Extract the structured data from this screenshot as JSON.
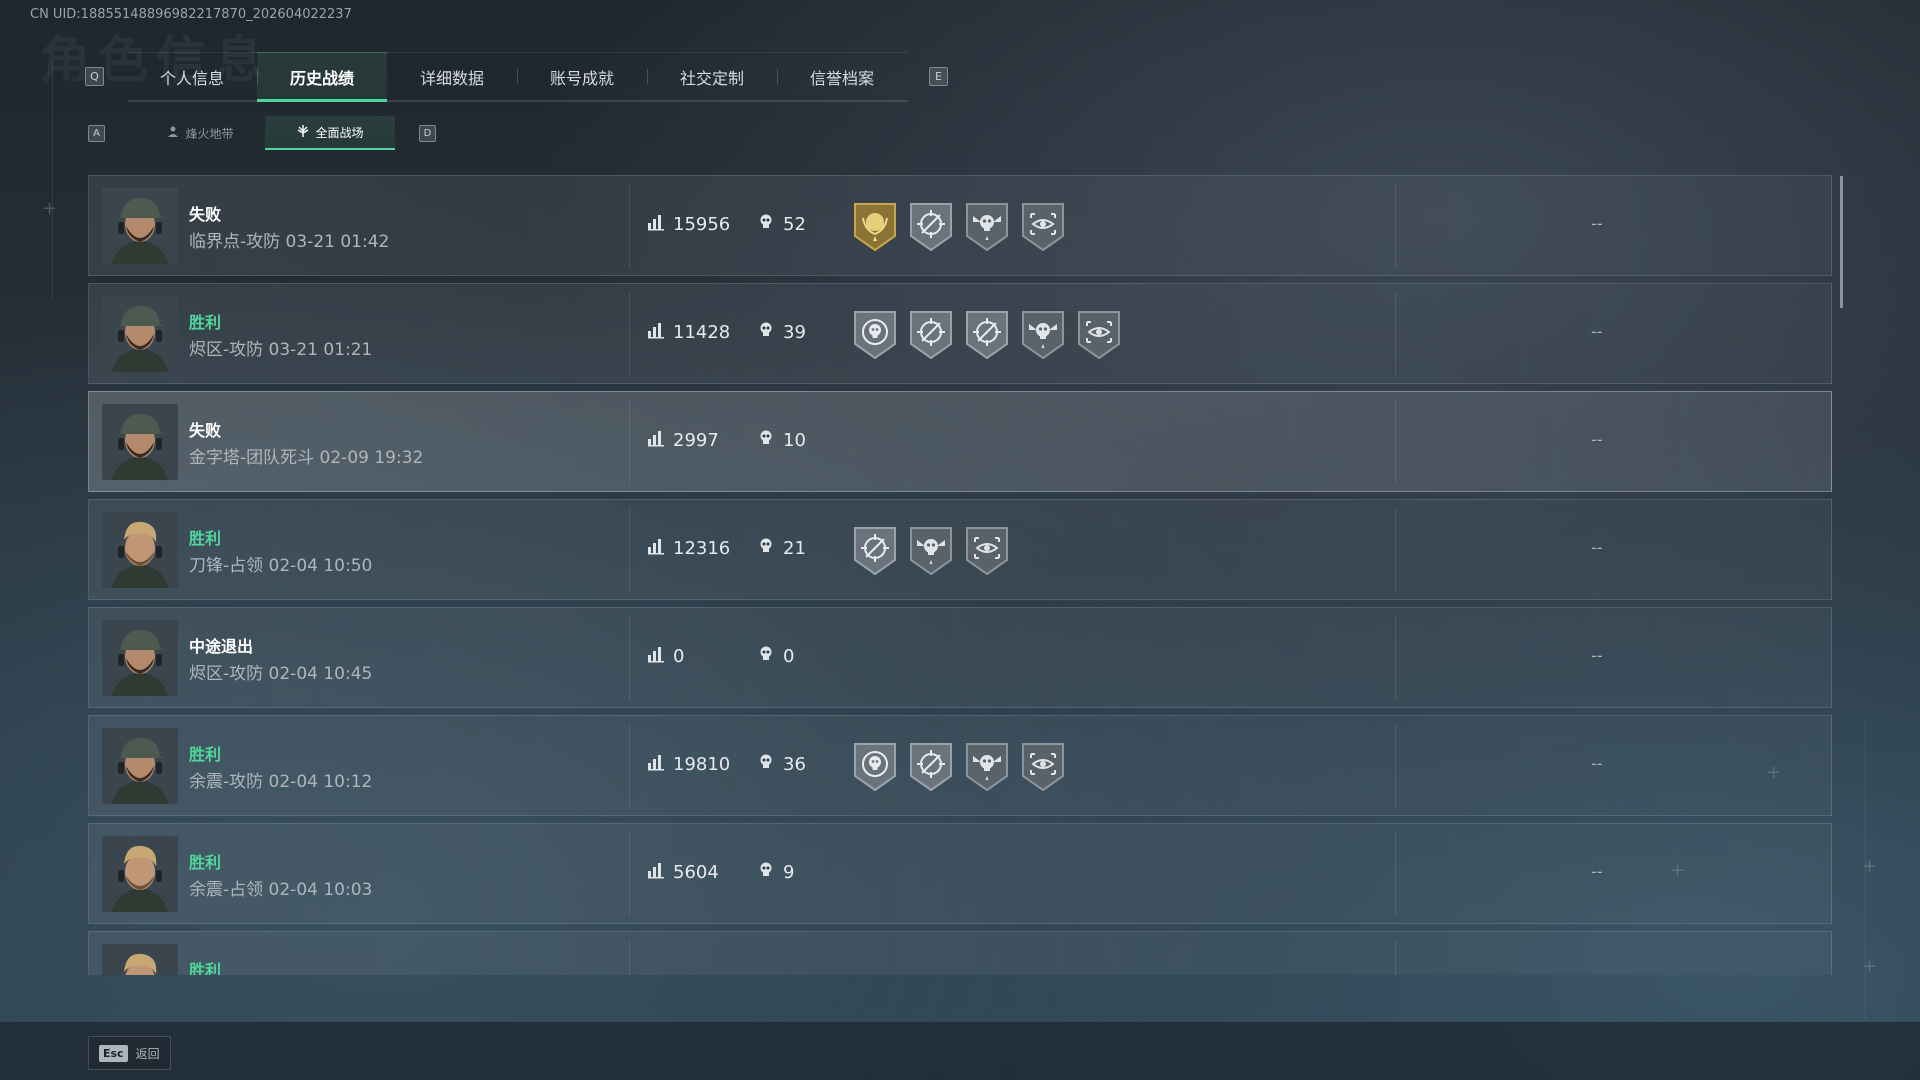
{
  "uid_text": "CN UID:1885514889698221787​0_202604022237",
  "bg_title": "角色信息",
  "tabs": {
    "left_key": "Q",
    "right_key": "E",
    "items": [
      {
        "label": "个人信息",
        "active": false
      },
      {
        "label": "历史战绩",
        "active": true
      },
      {
        "label": "详细数据",
        "active": false
      },
      {
        "label": "账号成就",
        "active": false
      },
      {
        "label": "社交定制",
        "active": false
      },
      {
        "label": "信誉档案",
        "active": false
      }
    ]
  },
  "subtabs": {
    "left_key": "A",
    "right_key": "D",
    "items": [
      {
        "label": "烽火地带",
        "active": false,
        "icon": "operator-icon"
      },
      {
        "label": "全面战场",
        "active": true,
        "icon": "battlefield-icon"
      }
    ]
  },
  "matches": [
    {
      "result": "失败",
      "win": false,
      "map_mode": "临界点-攻防",
      "time": "03-21 01:42",
      "score": "15956",
      "kills": "52",
      "medals": [
        "gold-laurel-medal",
        "crosshair-medal",
        "skull-wings-medal",
        "eye-target-medal"
      ],
      "extra": "--",
      "avatar": "capped-soldier"
    },
    {
      "result": "胜利",
      "win": true,
      "map_mode": "烬区-攻防",
      "time": "03-21 01:21",
      "score": "11428",
      "kills": "39",
      "medals": [
        "skull-target-medal",
        "crosshair-medal",
        "crosshair-medal",
        "skull-wings-medal",
        "eye-target-medal"
      ],
      "extra": "--",
      "avatar": "capped-soldier"
    },
    {
      "result": "失败",
      "win": false,
      "map_mode": "金字塔-团队死斗",
      "time": "02-09 19:32",
      "score": "2997",
      "kills": "10",
      "medals": [],
      "extra": "--",
      "avatar": "capped-soldier"
    },
    {
      "result": "胜利",
      "win": true,
      "map_mode": "刀锋-占领",
      "time": "02-04 10:50",
      "score": "12316",
      "kills": "21",
      "medals": [
        "crosshair-medal",
        "skull-wings-medal",
        "eye-target-medal"
      ],
      "extra": "--",
      "avatar": "blond-soldier"
    },
    {
      "result": "中途退出",
      "win": false,
      "map_mode": "烬区-攻防",
      "time": "02-04 10:45",
      "score": "0",
      "kills": "0",
      "medals": [],
      "extra": "--",
      "avatar": "capped-soldier"
    },
    {
      "result": "胜利",
      "win": true,
      "map_mode": "余震-攻防",
      "time": "02-04 10:12",
      "score": "19810",
      "kills": "36",
      "medals": [
        "skull-target-medal",
        "crosshair-medal",
        "skull-wings-medal",
        "eye-target-medal"
      ],
      "extra": "--",
      "avatar": "capped-soldier"
    },
    {
      "result": "胜利",
      "win": true,
      "map_mode": "余震-占领",
      "time": "02-04 10:03",
      "score": "5604",
      "kills": "9",
      "medals": [],
      "extra": "--",
      "avatar": "blond-soldier"
    },
    {
      "result": "胜利",
      "win": true,
      "map_mode": "",
      "time": "",
      "score": "",
      "kills": "",
      "medals": [],
      "extra": "",
      "avatar": "blond-soldier"
    }
  ],
  "highlight_row": 2,
  "footer": {
    "esc_key": "Esc",
    "esc_label": "返回"
  },
  "colors": {
    "accent": "#4fd3a0",
    "win": "#4fd69c",
    "gold": "#c9a64a"
  }
}
